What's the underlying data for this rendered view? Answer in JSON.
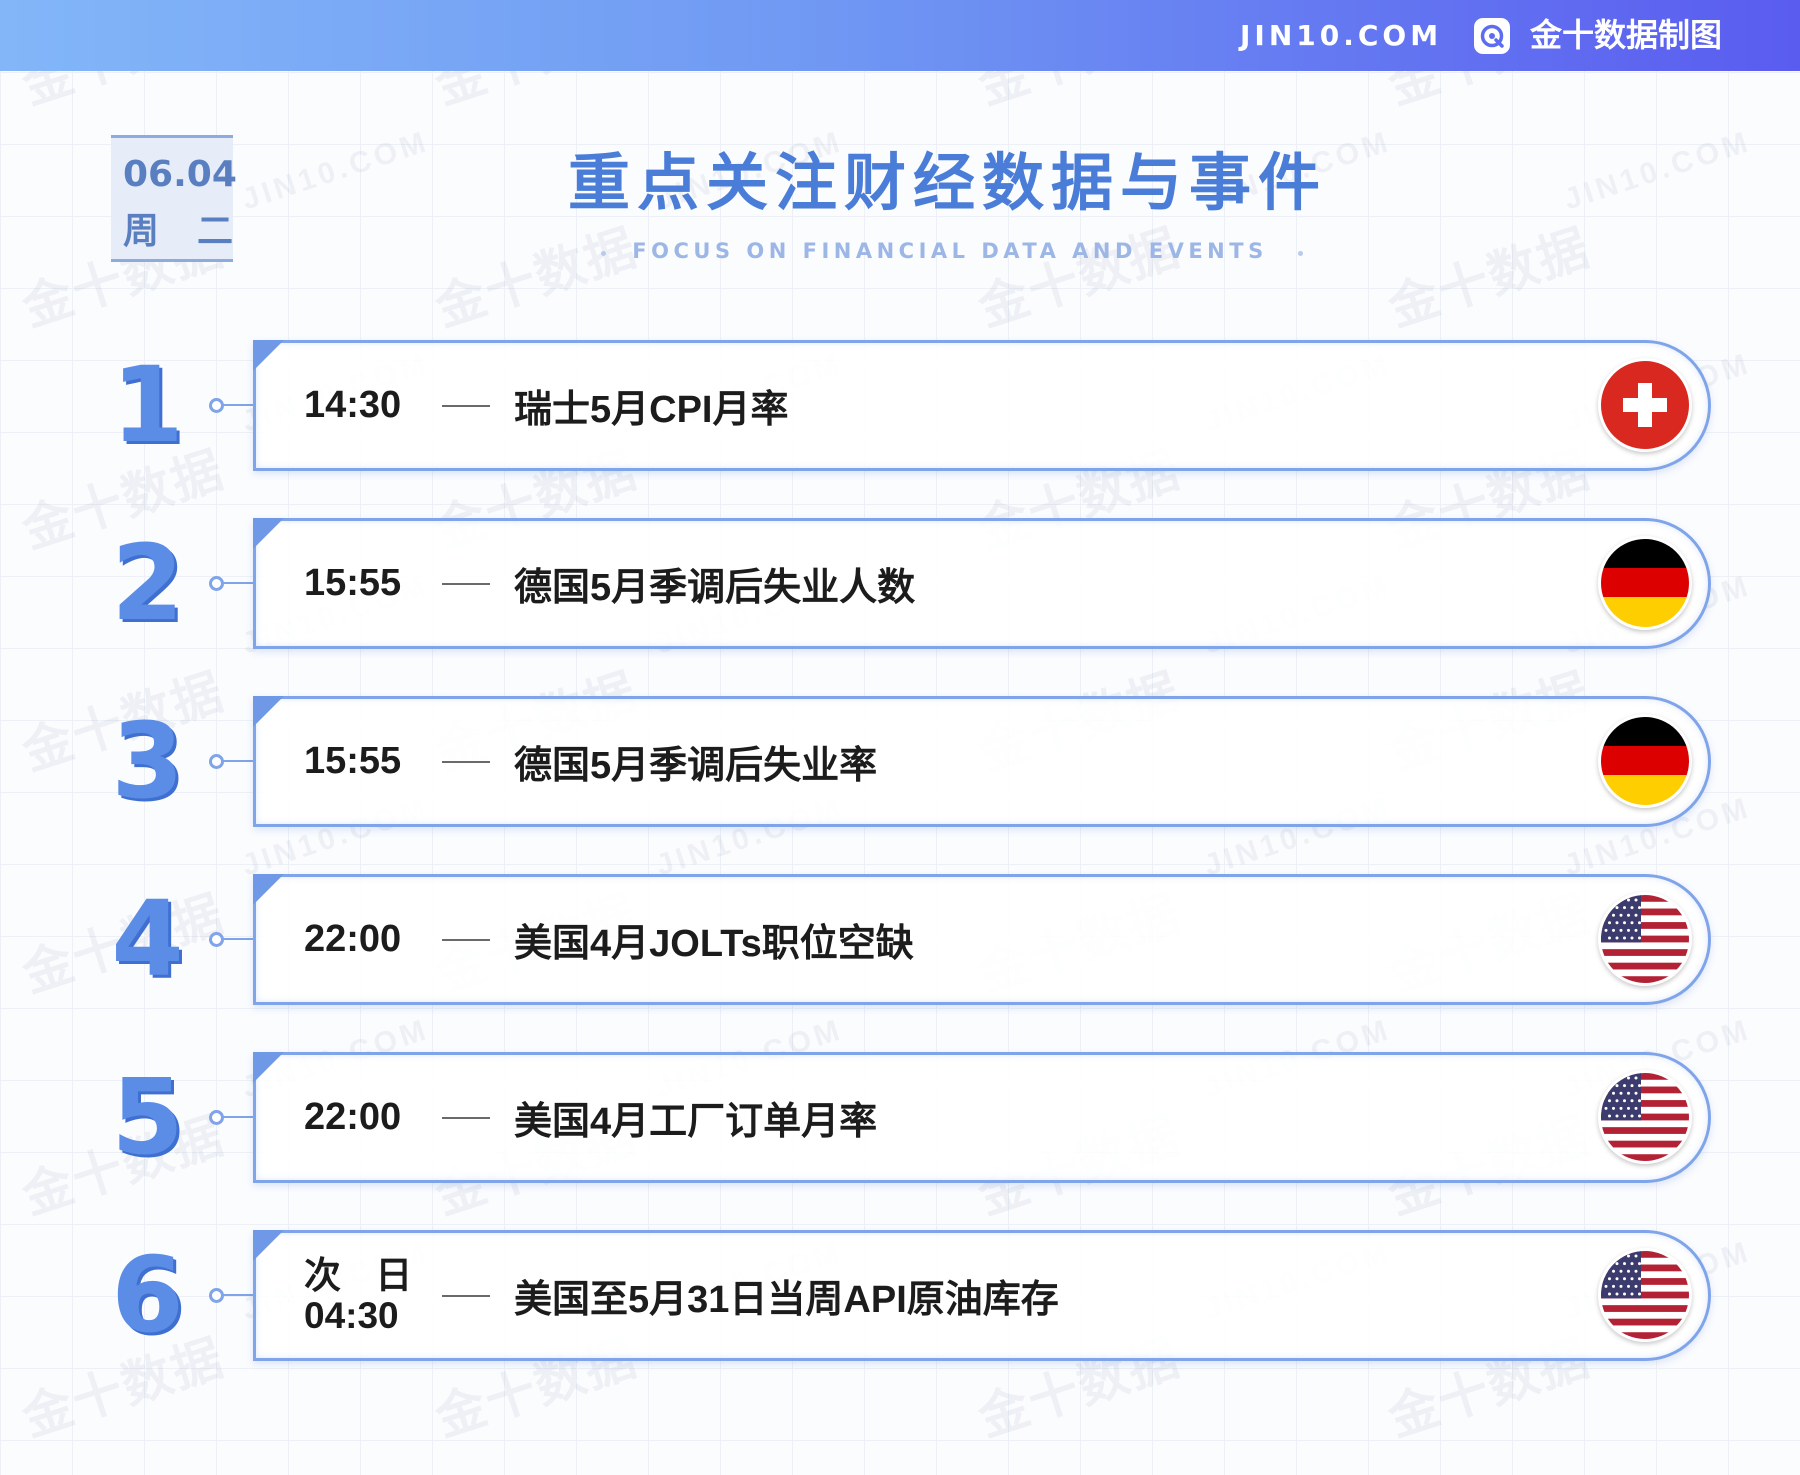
{
  "header": {
    "site_label": "JIN10.COM",
    "brand_label": "金十数据制图",
    "logo_icon": "jin10-logo-icon"
  },
  "date": {
    "day": "06.04",
    "weekday": "周 二"
  },
  "title": "重点关注财经数据与事件",
  "subtitle": "FOCUS ON FINANCIAL DATA AND EVENTS",
  "watermark": {
    "cn": "金十数据",
    "en": "JIN10.COM"
  },
  "events": [
    {
      "index": "1",
      "time": "14:30",
      "name": "瑞士5月CPI月率",
      "flag_icon": "switzerland-flag-icon"
    },
    {
      "index": "2",
      "time": "15:55",
      "name": "德国5月季调后失业人数",
      "flag_icon": "germany-flag-icon"
    },
    {
      "index": "3",
      "time": "15:55",
      "name": "德国5月季调后失业率",
      "flag_icon": "germany-flag-icon"
    },
    {
      "index": "4",
      "time": "22:00",
      "name": "美国4月JOLTs职位空缺",
      "flag_icon": "usa-flag-icon"
    },
    {
      "index": "5",
      "time": "22:00",
      "name": "美国4月工厂订单月率",
      "flag_icon": "usa-flag-icon"
    },
    {
      "index": "6",
      "time_day": "次 日",
      "time": "04:30",
      "name": "美国至5月31日当周API原油库存",
      "flag_icon": "usa-flag-icon"
    }
  ],
  "colors": {
    "header_start": "#82b6f8",
    "header_end": "#5a5cf0",
    "title": "#4a7dd8",
    "card_border": "#7fa4e9",
    "number": "#5b8de6",
    "swiss_red": "#d8281f",
    "german_black": "#000000",
    "german_red": "#dd0000",
    "german_gold": "#ffce00",
    "us_red": "#b22234",
    "us_blue": "#3c3b6e"
  }
}
